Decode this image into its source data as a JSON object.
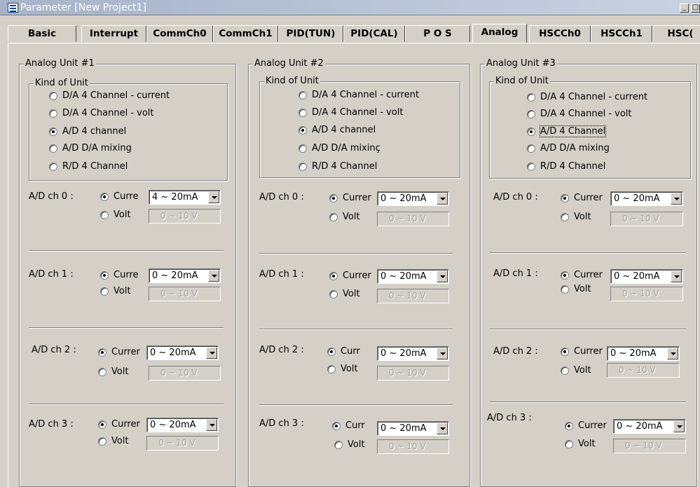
{
  "window": {
    "title": "Parameter [New Project1]",
    "min_label": "_",
    "max_label": "□"
  },
  "tabs": [
    "Basic",
    "Interrupt",
    "CommCh0",
    "CommCh1",
    "PID(TUN)",
    "PID(CAL)",
    "P O S",
    "Analog",
    "HSCCh0",
    "HSCCh1",
    "HSC("
  ],
  "active_tab": "Analog",
  "units": [
    {
      "title": "Analog Unit #1",
      "kind_title": "Kind of Unit",
      "kinds": [
        "D/A 4 Channel - current",
        "D/A 4 Channel - volt",
        "A/D 4 channel",
        "A/D D/A mixing",
        "R/D 4 Channel"
      ],
      "selected_kind": 2,
      "channels": [
        {
          "label": "A/D ch 0 :",
          "current": "Curre",
          "volt": "Volt",
          "range": "4 ~ 20mA",
          "volt_range": "0 ~ 10 V"
        },
        {
          "label": "A/D ch 1 :",
          "current": "Curre",
          "volt": "Volt",
          "range": "0 ~ 20mA",
          "volt_range": "0 ~ 10 V"
        },
        {
          "label": "A/D ch 2 :",
          "current": "Currer",
          "volt": "Volt",
          "range": "0 ~ 20mA",
          "volt_range": "0 ~ 10 V"
        },
        {
          "label": "A/D ch 3 :",
          "current": "Currer",
          "volt": "Volt",
          "range": "0 ~ 20mA",
          "volt_range": "0 ~ 10 V"
        }
      ]
    },
    {
      "title": "Analog Unit #2",
      "kind_title": "Kind of Unit",
      "kinds": [
        "D/A 4 Channel - current",
        "D/A 4 Channel - volt",
        "A/D 4 channel",
        "A/D D/A mixinç",
        "R/D 4 Channel"
      ],
      "selected_kind": 2,
      "channels": [
        {
          "label": "A/D ch 0 :",
          "current": "Currer",
          "volt": "Volt",
          "range": "0 ~ 20mA",
          "volt_range": "0 ~ 10 V"
        },
        {
          "label": "A/D ch 1 :",
          "current": "Currer",
          "volt": "Volt",
          "range": "0 ~ 20mA",
          "volt_range": "0 ~ 10 V"
        },
        {
          "label": "A/D ch 2 :",
          "current": "Curr",
          "volt": "Volt",
          "range": "0 ~ 20mA",
          "volt_range": "0 ~ 10 V"
        },
        {
          "label": "A/D ch 3 :",
          "current": "Curr",
          "volt": "Volt",
          "range": "0 ~ 20mA",
          "volt_range": "0 ~ 10 V"
        }
      ]
    },
    {
      "title": "Analog Unit #3",
      "kind_title": "Kind of Unit",
      "kinds": [
        "D/A 4 Channel - current",
        "D/A 4 Channel - volt",
        "A/D 4 Channel",
        "A/D D/A mixing",
        "R/D 4 Channel"
      ],
      "selected_kind": 2,
      "channels": [
        {
          "label": "A/D ch 0 :",
          "current": "Currer",
          "volt": "Volt",
          "range": "0 ~ 20mA",
          "volt_range": "0 ~ 10 V"
        },
        {
          "label": "A/D ch 1 :",
          "current": "Currer",
          "volt": "Volt",
          "range": "0 ~ 20mA",
          "volt_range": "0 ~ 10 V"
        },
        {
          "label": "A/D ch 2 :",
          "current": "Currer",
          "volt": "Volt",
          "range": "0 ~ 20mA",
          "volt_range": "0 ~ 10 V"
        },
        {
          "label": "A/D ch 3 :",
          "current": "Currer",
          "volt": "Volt",
          "range": "0 ~ 20mA",
          "volt_range": "0 ~ 10 V"
        }
      ]
    }
  ]
}
